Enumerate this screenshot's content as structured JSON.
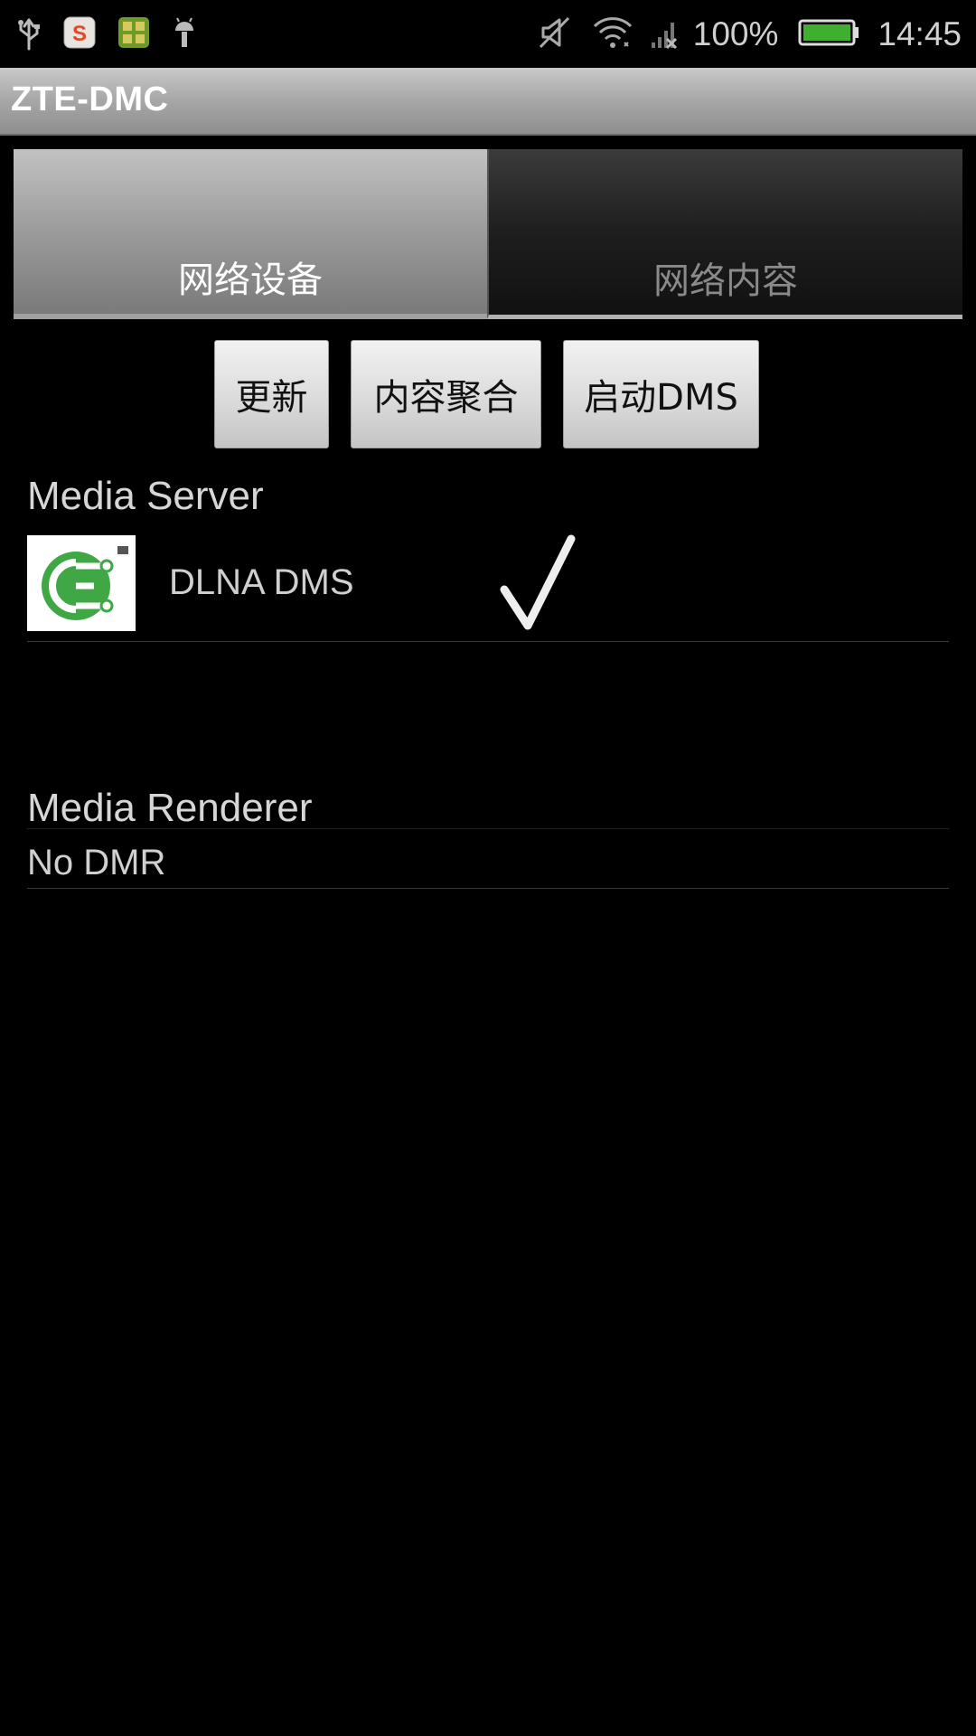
{
  "status_bar": {
    "battery_percent": "100%",
    "time": "14:45",
    "icons_left": [
      "usb-icon",
      "sogou-input-icon",
      "app-notification-icon",
      "android-debug-icon"
    ],
    "icons_right": [
      "mute-icon",
      "wifi-icon",
      "no-signal-icon",
      "battery-icon"
    ]
  },
  "app": {
    "title": "ZTE-DMC"
  },
  "tabs": [
    {
      "label": "网络设备",
      "selected": true
    },
    {
      "label": "网络内容",
      "selected": false
    }
  ],
  "actions": {
    "refresh_label": "更新",
    "aggregate_label": "内容聚合",
    "start_dms_label": "启动DMS"
  },
  "media_server": {
    "heading": "Media Server",
    "devices": [
      {
        "name": "DLNA DMS",
        "selected": true,
        "icon": "dlna-logo-icon"
      }
    ]
  },
  "media_renderer": {
    "heading": "Media Renderer",
    "empty_text": "No DMR"
  },
  "colors": {
    "background": "#000000",
    "logo_green": "#3fa845"
  }
}
